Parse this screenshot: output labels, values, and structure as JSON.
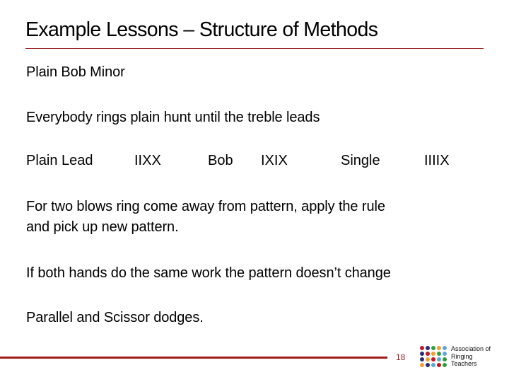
{
  "slide": {
    "title": "Example Lessons – Structure of Methods",
    "page_number": "18"
  },
  "body": {
    "method_name": "Plain Bob Minor",
    "intro": "Everybody rings plain hunt until the treble leads",
    "lead_patterns": [
      {
        "label": "Plain Lead",
        "pattern": "IIXX"
      },
      {
        "label": "Bob",
        "pattern": "IXIX"
      },
      {
        "label": "Single",
        "pattern": "IIIIX"
      }
    ],
    "rule_line_1": "For two blows ring come away from pattern, apply the rule",
    "rule_line_2": "and pick up new pattern.",
    "same_work_note": "If both hands do the same work the pattern doesn’t change",
    "dodges_note": "Parallel and Scissor dodges."
  },
  "logo": {
    "line_1": "Association of",
    "line_2": "Ringing",
    "line_3": "Teachers",
    "dot_colors": [
      [
        "#c4161c",
        "#2b2a7a",
        "#2e9e3e",
        "#f0a030",
        "#5ea6d6"
      ],
      [
        "#2b2a7a",
        "#c4161c",
        "#f0a030",
        "#2e9e3e",
        "#5ea6d6"
      ],
      [
        "#2b2a7a",
        "#f0a030",
        "#c4161c",
        "#5ea6d6",
        "#2e9e3e"
      ],
      [
        "#f0a030",
        "#2b2a7a",
        "#5ea6d6",
        "#c4161c",
        "#2e9e3e"
      ]
    ]
  },
  "colors": {
    "accent_red": "#9b1c1c"
  }
}
